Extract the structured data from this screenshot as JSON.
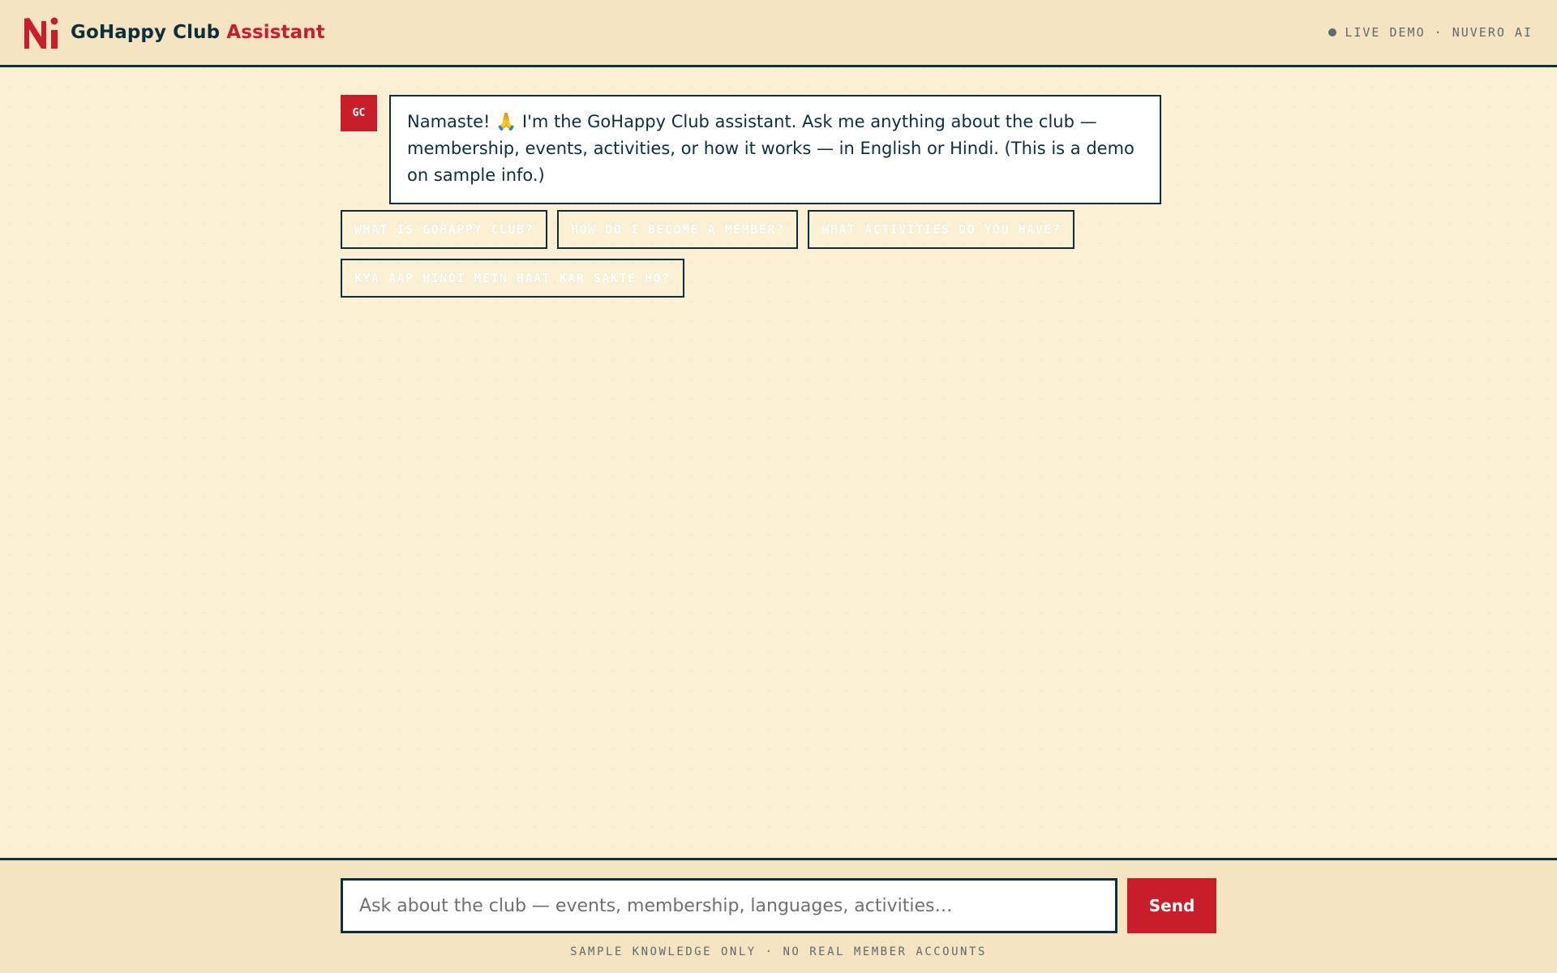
{
  "header": {
    "logo_text": "Ni",
    "title": "GoHappy Club",
    "title_accent": "Assistant",
    "status": "LIVE DEMO · NUVERO AI"
  },
  "colors": {
    "accent": "#c81e2a",
    "navy": "#0f2e3d",
    "background": "#fcf0d4",
    "header_bg": "#f5e4c2"
  },
  "chat": {
    "messages": [
      {
        "avatar": "GC",
        "text": "Namaste! 🙏 I'm the GoHappy Club assistant. Ask me anything about the club — membership, events, activities, or how it works — in English or Hindi. (This is a demo on sample info.)"
      }
    ],
    "suggestions": [
      "WHAT IS GOHAPPY CLUB?",
      "HOW DO I BECOME A MEMBER?",
      "WHAT ACTIVITIES DO YOU HAVE?",
      "KYA AAP HINDI MEIN BAAT KAR SAKTE HO?"
    ]
  },
  "composer": {
    "placeholder": "Ask about the club — events, membership, languages, activities…",
    "value": "",
    "send_label": "Send",
    "disclaimer": "SAMPLE KNOWLEDGE ONLY · NO REAL MEMBER ACCOUNTS"
  }
}
